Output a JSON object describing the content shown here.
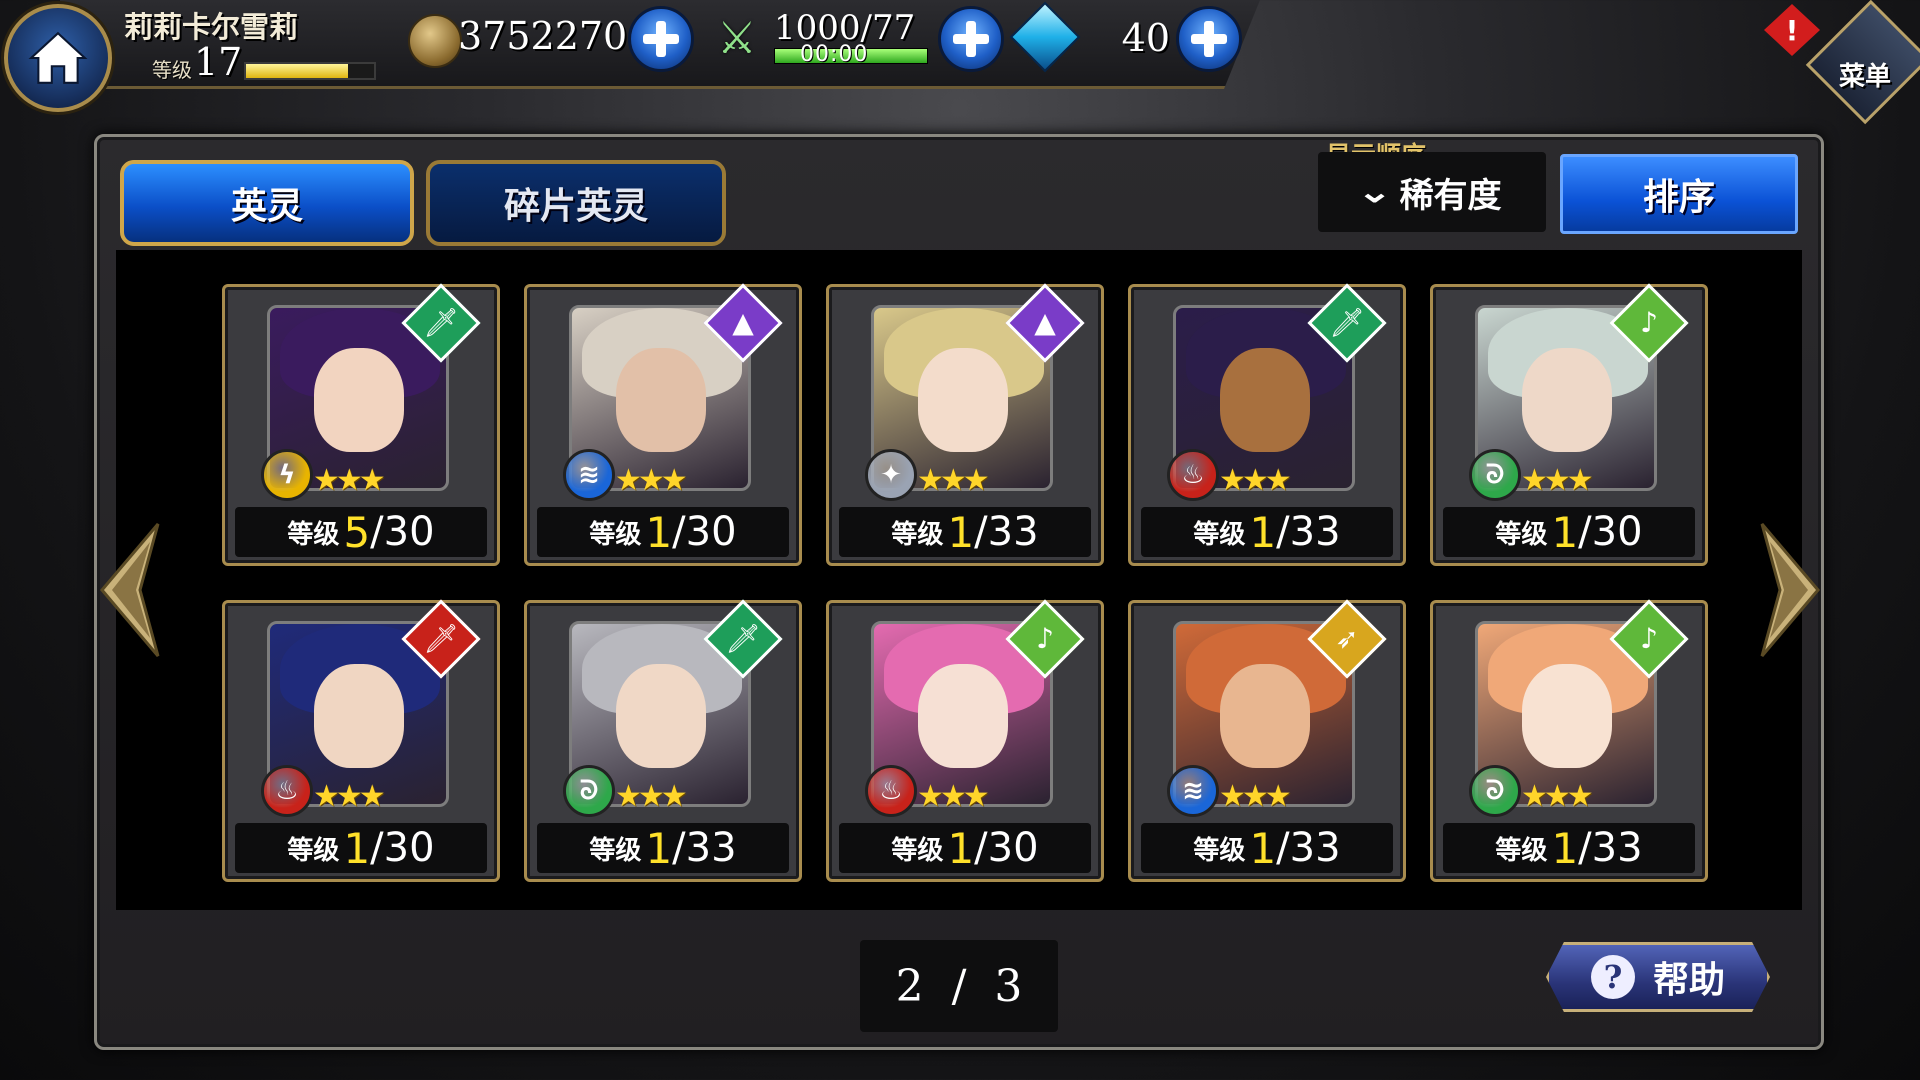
{
  "player": {
    "name": "莉莉卡尔雪莉",
    "level_label": "等级",
    "level": "17",
    "xp_fraction": 0.8
  },
  "resources": {
    "gold": "3752270",
    "stamina": "1000/77",
    "stamina_timer": "00:00",
    "stamina_fraction": 1.0,
    "gems": "40"
  },
  "menu": {
    "label": "菜单",
    "alert": "!"
  },
  "tabs": [
    {
      "label": "英灵",
      "active": true
    },
    {
      "label": "碎片英灵",
      "active": false
    }
  ],
  "sort": {
    "caption": "显示顺序",
    "selected": "稀有度",
    "button_label": "排序"
  },
  "level_label": "等级",
  "cards": [
    {
      "class_icon": "sword-icon",
      "class_color": "#1e9e5a",
      "element": "thunder",
      "element_color": "#e8b400",
      "stars": 3,
      "hair": "#3a1b5e",
      "skin": "#f2d4c0",
      "level": "5",
      "max": "30"
    },
    {
      "class_icon": "wizard-hat-icon",
      "class_color": "#7a3cc8",
      "element": "water",
      "element_color": "#1a66d8",
      "stars": 3,
      "hair": "#d8d0c4",
      "skin": "#e2c0a8",
      "level": "1",
      "max": "30"
    },
    {
      "class_icon": "wizard-hat-icon",
      "class_color": "#7a3cc8",
      "element": "wind",
      "element_color": "#9aa3b3",
      "stars": 3,
      "hair": "#d9c88a",
      "skin": "#f3dccb",
      "level": "1",
      "max": "33"
    },
    {
      "class_icon": "sword-icon",
      "class_color": "#1e9e5a",
      "element": "fire",
      "element_color": "#c8221a",
      "stars": 3,
      "hair": "#2b1d4a",
      "skin": "#a8703e",
      "level": "1",
      "max": "33"
    },
    {
      "class_icon": "lute-icon",
      "class_color": "#5fb83a",
      "element": "earth",
      "element_color": "#2ea84a",
      "stars": 3,
      "hair": "#c9d6d0",
      "skin": "#eed8c8",
      "level": "1",
      "max": "30"
    },
    {
      "class_icon": "sword-icon",
      "class_color": "#c8221a",
      "element": "fire",
      "element_color": "#c8221a",
      "stars": 3,
      "hair": "#1f2a7a",
      "skin": "#f0d6c2",
      "level": "1",
      "max": "30"
    },
    {
      "class_icon": "sword-icon",
      "class_color": "#1e9e5a",
      "element": "earth",
      "element_color": "#2ea84a",
      "stars": 3,
      "hair": "#b8b8be",
      "skin": "#f0d8c6",
      "level": "1",
      "max": "33"
    },
    {
      "class_icon": "lute-icon",
      "class_color": "#5fb83a",
      "element": "fire",
      "element_color": "#c8221a",
      "stars": 3,
      "hair": "#e46bb0",
      "skin": "#f6e0d4",
      "level": "1",
      "max": "30"
    },
    {
      "class_icon": "bow-icon",
      "class_color": "#d8a61e",
      "element": "water",
      "element_color": "#1a66d8",
      "stars": 3,
      "hair": "#d06a38",
      "skin": "#e8b690",
      "level": "1",
      "max": "33"
    },
    {
      "class_icon": "lute-icon",
      "class_color": "#5fb83a",
      "element": "earth",
      "element_color": "#2ea84a",
      "stars": 3,
      "hair": "#f0a878",
      "skin": "#f8e2d2",
      "level": "1",
      "max": "33"
    }
  ],
  "pager": {
    "text": "2 / 3"
  },
  "help": {
    "label": "帮助",
    "icon": "?"
  }
}
